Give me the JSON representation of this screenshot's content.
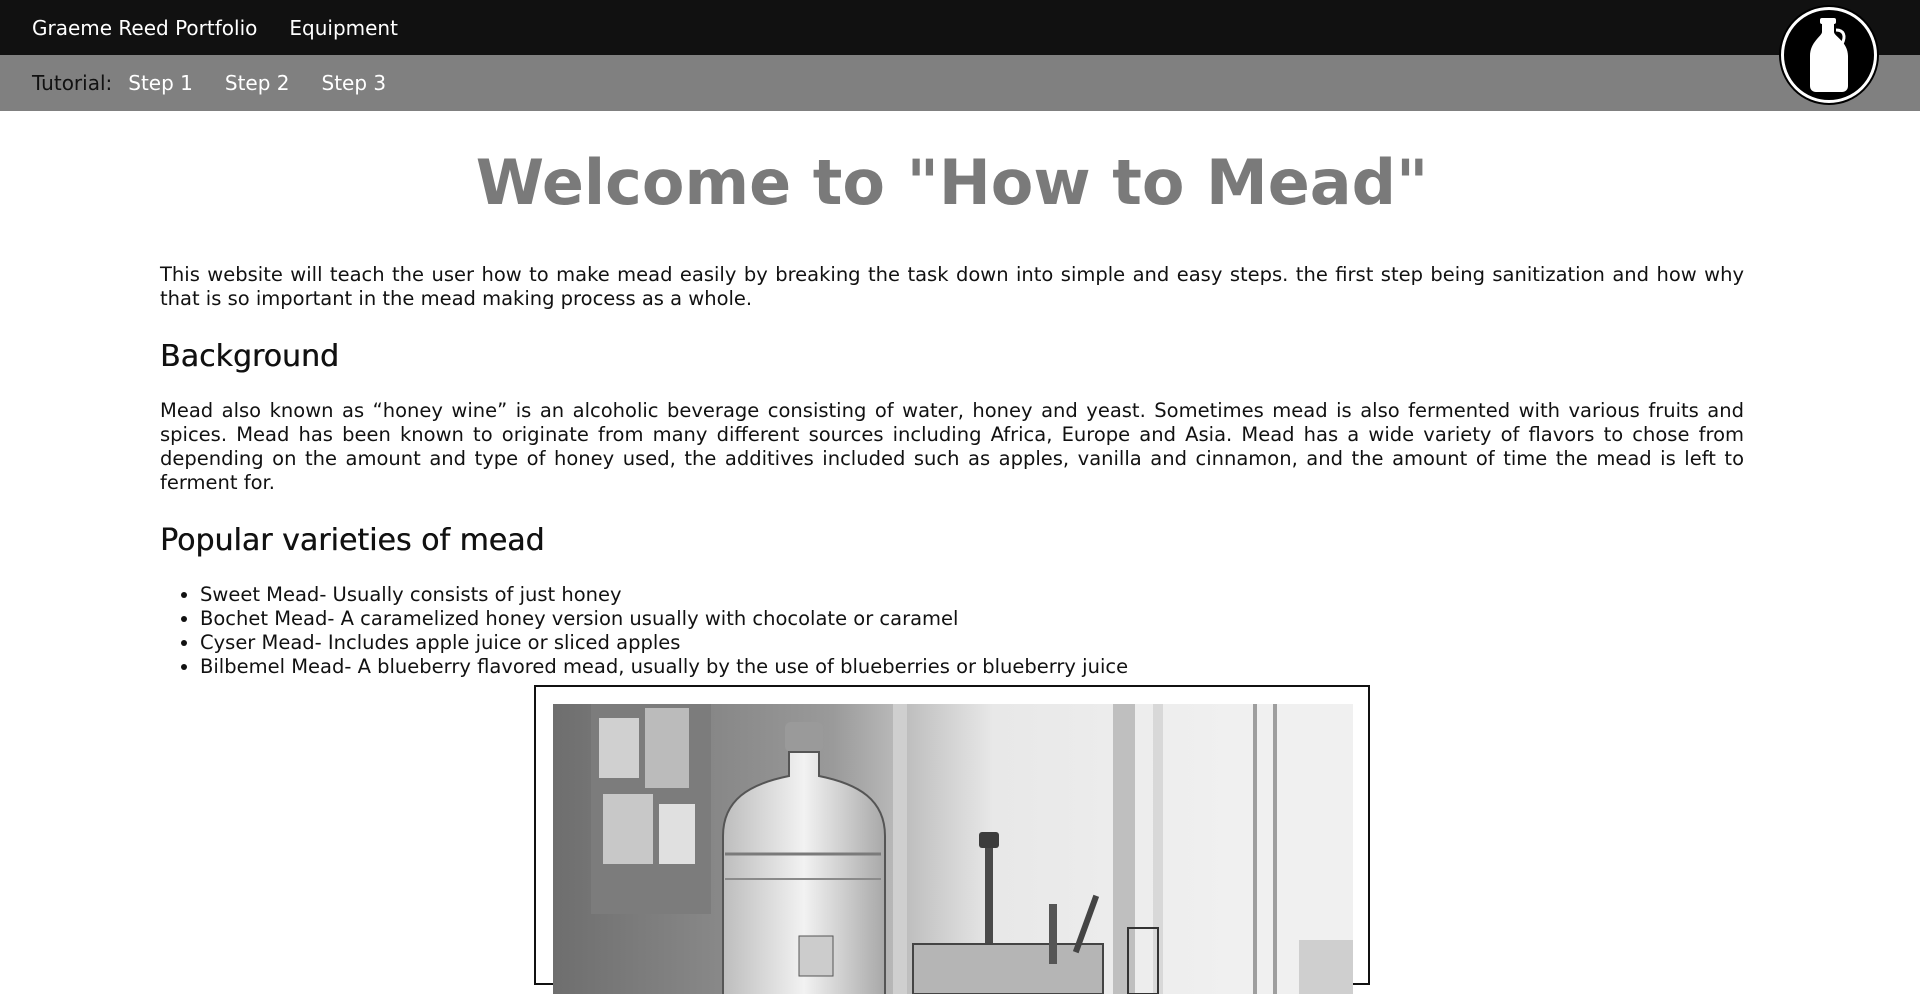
{
  "nav": {
    "brand": "Graeme Reed Portfolio",
    "items": [
      "Equipment"
    ]
  },
  "subnav": {
    "label": "Tutorial:",
    "steps": [
      "Step 1",
      "Step 2",
      "Step 3"
    ]
  },
  "logo": {
    "icon": "mead-jug-icon"
  },
  "main": {
    "title": "Welcome to \"How to Mead\"",
    "intro": "This website will teach the user how to make mead easily by breaking the task down into simple and easy steps. the first step being sanitization and how why that is so important in the mead making process as a whole.",
    "background_heading": "Background",
    "background_text": "Mead also known as “honey wine” is an alcoholic beverage consisting of water, honey and yeast. Sometimes mead is also fermented with various fruits and spices. Mead has been known to originate from many different sources including Africa, Europe and Asia. Mead has a wide variety of flavors to chose from depending on the amount and type of honey used, the additives included such as apples, vanilla and cinnamon, and the amount of time the mead is left to ferment for.",
    "varieties_heading": "Popular varieties of mead",
    "varieties": [
      "Sweet Mead- Usually consists of just honey",
      "Bochet Mead- A caramelized honey version usually with chocolate or caramel",
      "Cyser Mead- Includes apple juice or sliced apples",
      "Bilbemel Mead- A blueberry flavored mead, usually by the use of blueberries or blueberry juice"
    ]
  },
  "colors": {
    "topbar": "#111111",
    "subbar": "#808080",
    "title": "#7a7a7a"
  }
}
